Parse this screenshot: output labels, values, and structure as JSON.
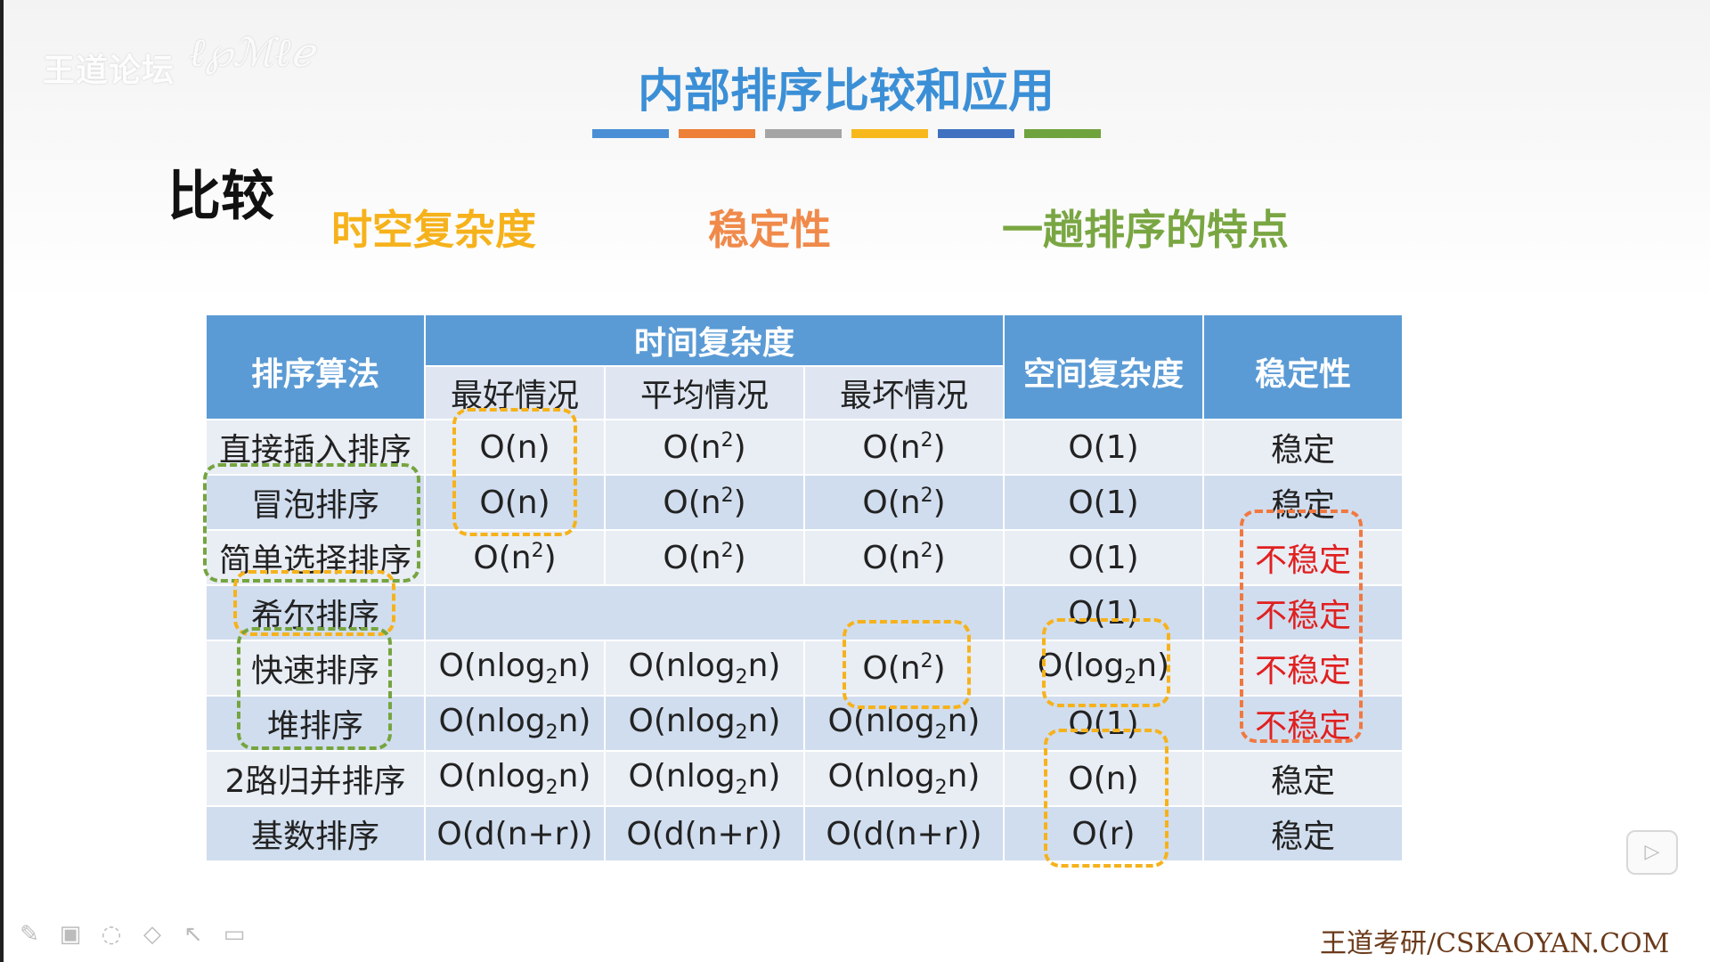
{
  "watermark": {
    "logo_text": "王道论坛",
    "script_text": "ℓ℘ℳℓℯ"
  },
  "slide": {
    "title": "内部排序比较和应用",
    "accent_colors": [
      "#4a8fd6",
      "#ee7f37",
      "#a5a5a5",
      "#f6b81b",
      "#3f71c0",
      "#6fa33e"
    ],
    "section_label": "比较",
    "topics": [
      "时空复杂度",
      "稳定性",
      "一趟排序的特点"
    ]
  },
  "table": {
    "headers": {
      "algorithm": "排序算法",
      "time": "时间复杂度",
      "space": "空间复杂度",
      "stability": "稳定性",
      "best": "最好情况",
      "average": "平均情况",
      "worst": "最坏情况"
    },
    "rows": [
      {
        "name": "直接插入排序",
        "best": "O(n)",
        "avg": "O(n<sup>2</sup>)",
        "worst": "O(n<sup>2</sup>)",
        "space": "O(1)",
        "stability": "稳定",
        "unstable": false
      },
      {
        "name": "冒泡排序",
        "best": "O(n)",
        "avg": "O(n<sup>2</sup>)",
        "worst": "O(n<sup>2</sup>)",
        "space": "O(1)",
        "stability": "稳定",
        "unstable": false
      },
      {
        "name": "简单选择排序",
        "best": "O(n<sup>2</sup>)",
        "avg": "O(n<sup>2</sup>)",
        "worst": "O(n<sup>2</sup>)",
        "space": "O(1)",
        "stability": "不稳定",
        "unstable": true
      },
      {
        "name": "希尔排序",
        "best": "",
        "avg": "",
        "worst": "",
        "space": "O(1)",
        "stability": "不稳定",
        "unstable": true
      },
      {
        "name": "快速排序",
        "best": "O(nlog<sub>2</sub>n)",
        "avg": "O(nlog<sub>2</sub>n)",
        "worst": "O(n<sup>2</sup>)",
        "space": "O(log<sub>2</sub>n)",
        "stability": "不稳定",
        "unstable": true
      },
      {
        "name": "堆排序",
        "best": "O(nlog<sub>2</sub>n)",
        "avg": "O(nlog<sub>2</sub>n)",
        "worst": "O(nlog<sub>2</sub>n)",
        "space": "O(1)",
        "stability": "不稳定",
        "unstable": true
      },
      {
        "name": "2路归并排序",
        "best": "O(nlog<sub>2</sub>n)",
        "avg": "O(nlog<sub>2</sub>n)",
        "worst": "O(nlog<sub>2</sub>n)",
        "space": "O(n)",
        "stability": "稳定",
        "unstable": false
      },
      {
        "name": "基数排序",
        "best": "O(d(n+r))",
        "avg": "O(d(n+r))",
        "worst": "O(d(n+r))",
        "space": "O(r)",
        "stability": "稳定",
        "unstable": false
      }
    ]
  },
  "toolbar": {
    "icons": [
      "pen-icon",
      "whiteboard-icon",
      "eraser-ring-icon",
      "eraser-icon",
      "pointer-icon",
      "camera-icon"
    ]
  },
  "footer": {
    "text": "王道考研/CSKAOYAN.COM"
  },
  "player": {
    "icon": "play-icon"
  }
}
